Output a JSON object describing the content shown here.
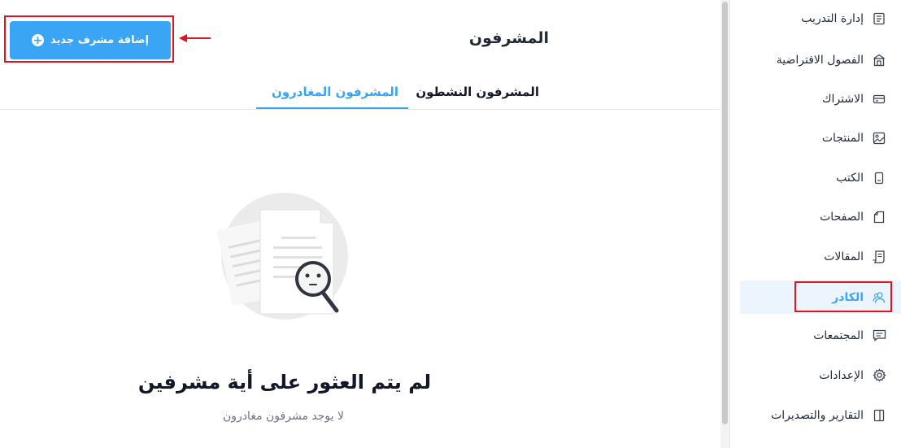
{
  "header": {
    "title": "المشرفون",
    "add_button_label": "إضافة مشرف جديد"
  },
  "tabs": [
    {
      "label": "المشرفون النشطون",
      "active": false
    },
    {
      "label": "المشرفون المغادرون",
      "active": true
    }
  ],
  "empty_state": {
    "title": "لم يتم العثور على أية مشرفين",
    "subtitle": "لا يوجد مشرفون مغادرون"
  },
  "sidebar": {
    "items": [
      {
        "label": "إدارة التدريب",
        "icon": "training-icon"
      },
      {
        "label": "الفصول الافتراضية",
        "icon": "classroom-icon"
      },
      {
        "label": "الاشتراك",
        "icon": "credit-card-icon"
      },
      {
        "label": "المنتجات",
        "icon": "image-icon"
      },
      {
        "label": "الكتب",
        "icon": "book-icon"
      },
      {
        "label": "الصفحات",
        "icon": "page-icon"
      },
      {
        "label": "المقالات",
        "icon": "scroll-icon"
      },
      {
        "label": "الكادر",
        "icon": "users-icon",
        "active": true
      },
      {
        "label": "المجتمعات",
        "icon": "chat-icon"
      },
      {
        "label": "الإعدادات",
        "icon": "gear-icon"
      },
      {
        "label": "التقارير والتصديرات",
        "icon": "report-icon"
      }
    ]
  },
  "colors": {
    "accent": "#3aa4f5",
    "highlight": "#e0141e",
    "active_bg": "#ecf5fd"
  }
}
